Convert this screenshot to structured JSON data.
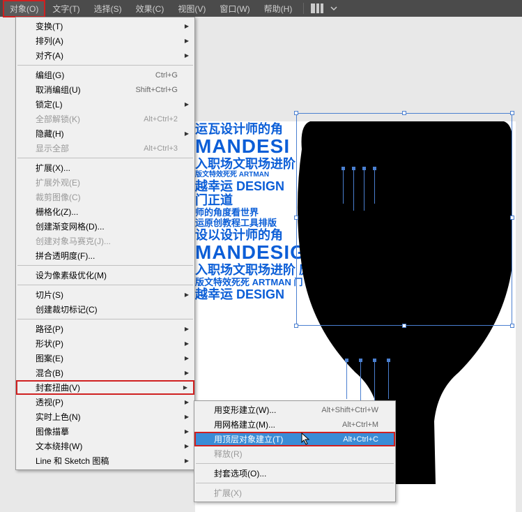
{
  "menubar": {
    "items": [
      {
        "label": "对象(O)",
        "active": true
      },
      {
        "label": "文字(T)"
      },
      {
        "label": "选择(S)"
      },
      {
        "label": "效果(C)"
      },
      {
        "label": "视图(V)"
      },
      {
        "label": "窗口(W)"
      },
      {
        "label": "帮助(H)"
      }
    ]
  },
  "dropdown": {
    "items": [
      {
        "label": "变换(T)",
        "has_sub": true
      },
      {
        "label": "排列(A)",
        "has_sub": true
      },
      {
        "label": "对齐(A)",
        "has_sub": true
      },
      {
        "sep": true
      },
      {
        "label": "编组(G)",
        "shortcut": "Ctrl+G"
      },
      {
        "label": "取消编组(U)",
        "shortcut": "Shift+Ctrl+G"
      },
      {
        "label": "锁定(L)",
        "has_sub": true
      },
      {
        "label": "全部解锁(K)",
        "shortcut": "Alt+Ctrl+2",
        "disabled": true
      },
      {
        "label": "隐藏(H)",
        "has_sub": true
      },
      {
        "label": "显示全部",
        "shortcut": "Alt+Ctrl+3",
        "disabled": true
      },
      {
        "sep": true
      },
      {
        "label": "扩展(X)..."
      },
      {
        "label": "扩展外观(E)",
        "disabled": true
      },
      {
        "label": "裁剪图像(C)",
        "disabled": true
      },
      {
        "label": "栅格化(Z)..."
      },
      {
        "label": "创建渐变网格(D)..."
      },
      {
        "label": "创建对象马赛克(J)...",
        "disabled": true
      },
      {
        "label": "拼合透明度(F)..."
      },
      {
        "sep": true
      },
      {
        "label": "设为像素级优化(M)"
      },
      {
        "sep": true
      },
      {
        "label": "切片(S)",
        "has_sub": true
      },
      {
        "label": "创建裁切标记(C)"
      },
      {
        "sep": true
      },
      {
        "label": "路径(P)",
        "has_sub": true
      },
      {
        "label": "形状(P)",
        "has_sub": true
      },
      {
        "label": "图案(E)",
        "has_sub": true
      },
      {
        "label": "混合(B)",
        "has_sub": true
      },
      {
        "label": "封套扭曲(V)",
        "has_sub": true,
        "highlighted": true
      },
      {
        "label": "透视(P)",
        "has_sub": true
      },
      {
        "label": "实时上色(N)",
        "has_sub": true
      },
      {
        "label": "图像描摹",
        "has_sub": true
      },
      {
        "label": "文本绕排(W)",
        "has_sub": true
      },
      {
        "label": "Line 和 Sketch 图稿",
        "has_sub": true
      }
    ]
  },
  "submenu": {
    "items": [
      {
        "label": "用变形建立(W)...",
        "shortcut": "Alt+Shift+Ctrl+W"
      },
      {
        "label": "用网格建立(M)...",
        "shortcut": "Alt+Ctrl+M"
      },
      {
        "label": "用顶层对象建立(T)",
        "shortcut": "Alt+Ctrl+C",
        "selected": true
      },
      {
        "label": "释放(R)",
        "disabled": true
      },
      {
        "sep": true
      },
      {
        "label": "封套选项(O)..."
      },
      {
        "sep": true
      },
      {
        "label": "扩展(X)",
        "disabled": true
      }
    ]
  },
  "canvas": {
    "text_lines": [
      {
        "text": "运瓦设计师的角",
        "cls": "t-med"
      },
      {
        "text": "MANDESI",
        "cls": "t-big"
      },
      {
        "text": "入职场文职场进阶",
        "cls": "t-med"
      },
      {
        "text": "版文特效死死 ARTMAN",
        "cls": "t-xs"
      },
      {
        "text": "越幸运 DESIGN",
        "cls": "t-med"
      },
      {
        "text": "门正道",
        "cls": "t-med"
      },
      {
        "text": "师的角度看世界",
        "cls": "t-sm"
      },
      {
        "text": "运原创教程工具排版",
        "cls": "t-sm"
      },
      {
        "text": "设以设计师的角",
        "cls": "t-med"
      },
      {
        "text": "MANDESIG",
        "cls": "t-big"
      },
      {
        "text": "入职场文职场进阶 庞",
        "cls": "t-med"
      },
      {
        "text": "版文特效死死 ARTMAN 门",
        "cls": "t-sm"
      },
      {
        "text": "越幸运 DESIGN",
        "cls": "t-med"
      }
    ]
  }
}
